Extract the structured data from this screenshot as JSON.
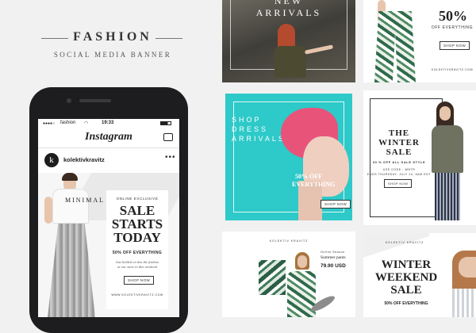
{
  "brand": {
    "title": "FASHION",
    "subtitle": "SOCIAL MEDIA BANNER"
  },
  "phone": {
    "carrier": "fashion",
    "time": "19:33",
    "app_name": "Instagram",
    "avatar_letter": "k",
    "username": "kolektivkravitz",
    "more": "•••",
    "post": {
      "tag": "MINIMAL",
      "label": "ONLINE EXCLUSIVE",
      "headline_1": "SALE",
      "headline_2": "STARTS",
      "headline_3": "TODAY",
      "offer": "50% OFF EVERYTHING",
      "body": "Just holded on this the fashion at our store in this weekend",
      "button": "SHOP NOW",
      "footer": "WWW.KOLEKTIVKRAVITZ.COM"
    }
  },
  "tiles": {
    "new_arrivals": {
      "line1": "NEW",
      "line2": "ARRIVALS"
    },
    "fifty_off": {
      "percent": "50%",
      "text": "OFF EVERYTHING",
      "button": "SHOP NOW",
      "footer": "KOLEKTIVKRAVITZ.COM"
    },
    "shop_dress": {
      "line1": "SHOP",
      "line2": "DRESS",
      "line3": "ARRIVALS",
      "offer1": "50% OFF",
      "offer2": "EVERYTHING",
      "button": "SHOP NOW"
    },
    "winter_sale": {
      "line1": "THE",
      "line2": "WINTER",
      "line3": "SALE",
      "offer": "30 % OFF ALL SALE STYLE",
      "detail1": "USE CODE : WNTR",
      "detail2": "ENDS THURSDAY, JULY 24, 6AM EDT",
      "button": "SHOP NOW"
    },
    "summer_pants": {
      "brand": "KOLEKTIV KRAVITZ",
      "label": "Online Season",
      "title": "Summer pants",
      "price": "79.90 USD"
    },
    "winter_weekend": {
      "brand": "KOLEKTIV KRAVITZ",
      "line1": "WINTER",
      "line2": "WEEKEND",
      "line3": "SALE",
      "offer": "50% OFF EVERYTHING"
    }
  },
  "colors": {
    "background": "#f1f1f1",
    "phone_body": "#1d1d1f",
    "turquoise": "#2ec9c9",
    "pink": "#e8537a"
  }
}
